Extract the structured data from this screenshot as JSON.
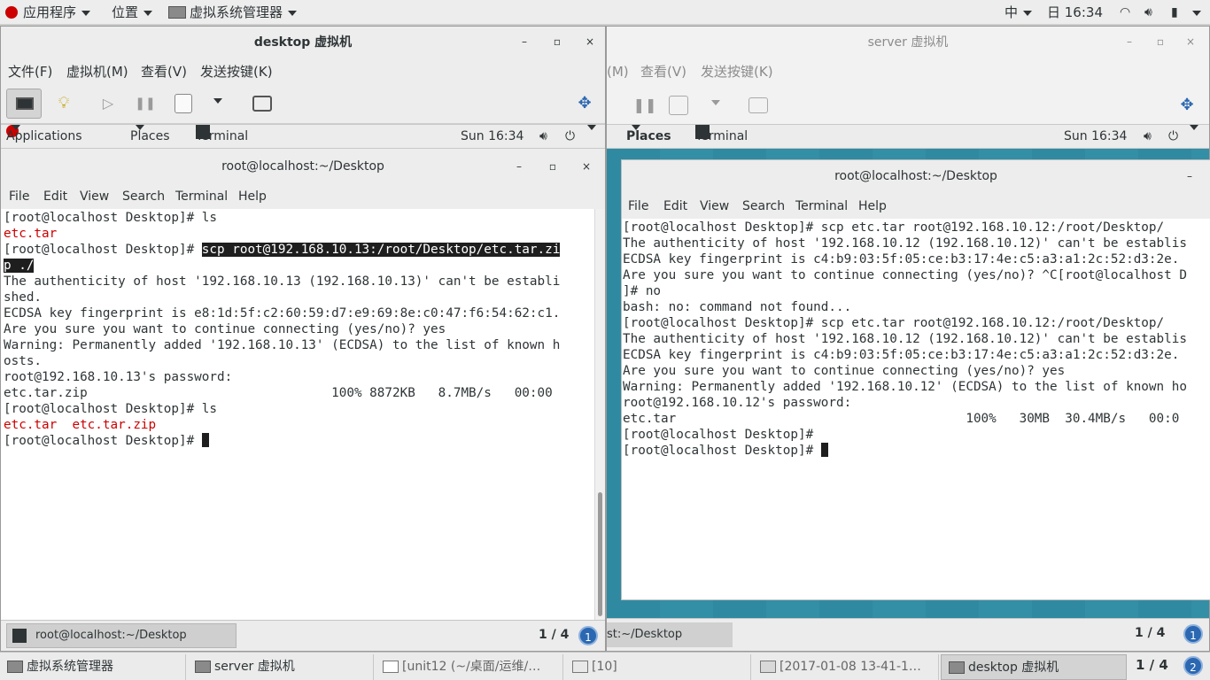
{
  "host_topbar": {
    "apps": "应用程序",
    "places": "位置",
    "app_name": "虚拟系统管理器",
    "input_method": "中",
    "clock": "日 16:34"
  },
  "desktop_vm": {
    "title": "desktop 虚拟机",
    "menu": [
      "文件(F)",
      "虚拟机(M)",
      "查看(V)",
      "发送按键(K)"
    ],
    "guest_bar": {
      "applications": "Applications",
      "places": "Places",
      "terminal": "Terminal",
      "clock": "Sun 16:34"
    },
    "terminal": {
      "title": "root@localhost:~/Desktop",
      "menu": [
        "File",
        "Edit",
        "View",
        "Search",
        "Terminal",
        "Help"
      ],
      "lines": [
        [
          {
            "t": "[root@localhost Desktop]# ls"
          }
        ],
        [
          {
            "t": "etc.tar",
            "c": "red"
          }
        ],
        [
          {
            "t": "[root@localhost Desktop]# "
          },
          {
            "t": "scp root@192.168.10.13:/root/Desktop/etc.tar.zi",
            "c": "sel"
          }
        ],
        [
          {
            "t": "p ./",
            "c": "sel"
          }
        ],
        [
          {
            "t": "The authenticity of host '192.168.10.13 (192.168.10.13)' can't be establi"
          }
        ],
        [
          {
            "t": "shed."
          }
        ],
        [
          {
            "t": "ECDSA key fingerprint is e8:1d:5f:c2:60:59:d7:e9:69:8e:c0:47:f6:54:62:c1."
          }
        ],
        [
          {
            "t": "Are you sure you want to continue connecting (yes/no)? yes"
          }
        ],
        [
          {
            "t": "Warning: Permanently added '192.168.10.13' (ECDSA) to the list of known h"
          }
        ],
        [
          {
            "t": "osts."
          }
        ],
        [
          {
            "t": "root@192.168.10.13's password: "
          }
        ],
        [
          {
            "t": "etc.tar.zip                                100% 8872KB   8.7MB/s   00:00"
          }
        ],
        [
          {
            "t": "[root@localhost Desktop]# ls"
          }
        ],
        [
          {
            "t": "etc.tar  etc.tar.zip",
            "c": "red"
          }
        ],
        [
          {
            "t": "[root@localhost Desktop]# "
          },
          {
            "cursor": true
          }
        ]
      ]
    },
    "taskbar_item": "root@localhost:~/Desktop",
    "pager": "1 / 4",
    "pager_num": "1"
  },
  "server_vm": {
    "title": "server 虚拟机",
    "menu": [
      "(M)",
      "查看(V)",
      "发送按键(K)"
    ],
    "guest_bar": {
      "places": "Places",
      "terminal": "Terminal",
      "clock": "Sun 16:34"
    },
    "terminal": {
      "title": "root@localhost:~/Desktop",
      "menu": [
        "File",
        "Edit",
        "View",
        "Search",
        "Terminal",
        "Help"
      ],
      "lines": [
        [
          {
            "t": "[root@localhost Desktop]# scp etc.tar root@192.168.10.12:/root/Desktop/"
          }
        ],
        [
          {
            "t": "The authenticity of host '192.168.10.12 (192.168.10.12)' can't be establis"
          }
        ],
        [
          {
            "t": "ECDSA key fingerprint is c4:b9:03:5f:05:ce:b3:17:4e:c5:a3:a1:2c:52:d3:2e."
          }
        ],
        [
          {
            "t": "Are you sure you want to continue connecting (yes/no)? ^C[root@localhost D"
          }
        ],
        [
          {
            "t": "]# no"
          }
        ],
        [
          {
            "t": "bash: no: command not found..."
          }
        ],
        [
          {
            "t": "[root@localhost Desktop]# scp etc.tar root@192.168.10.12:/root/Desktop/"
          }
        ],
        [
          {
            "t": "The authenticity of host '192.168.10.12 (192.168.10.12)' can't be establis"
          }
        ],
        [
          {
            "t": "ECDSA key fingerprint is c4:b9:03:5f:05:ce:b3:17:4e:c5:a3:a1:2c:52:d3:2e."
          }
        ],
        [
          {
            "t": "Are you sure you want to continue connecting (yes/no)? yes"
          }
        ],
        [
          {
            "t": "Warning: Permanently added '192.168.10.12' (ECDSA) to the list of known ho"
          }
        ],
        [
          {
            "t": "root@192.168.10.12's password: "
          }
        ],
        [
          {
            "t": "etc.tar                                      100%   30MB  30.4MB/s   00:0"
          }
        ],
        [
          {
            "t": "[root@localhost Desktop]#"
          }
        ],
        [
          {
            "t": "[root@localhost Desktop]# "
          },
          {
            "cursor": true
          }
        ]
      ]
    },
    "taskbar_item": "st:~/Desktop",
    "pager": "1 / 4",
    "pager_num": "1"
  },
  "host_taskbar": {
    "items": [
      "虚拟系统管理器",
      "server 虚拟机",
      "[unit12 (~/桌面/运维/…",
      "[10]",
      "[2017-01-08 13-41-1…",
      "desktop 虚拟机"
    ],
    "pager": "1 / 4",
    "pager_num": "2"
  },
  "colors": {
    "accent": "#2b68b1",
    "red_text": "#cc0000",
    "teal_bg": "#2e8aa0"
  }
}
